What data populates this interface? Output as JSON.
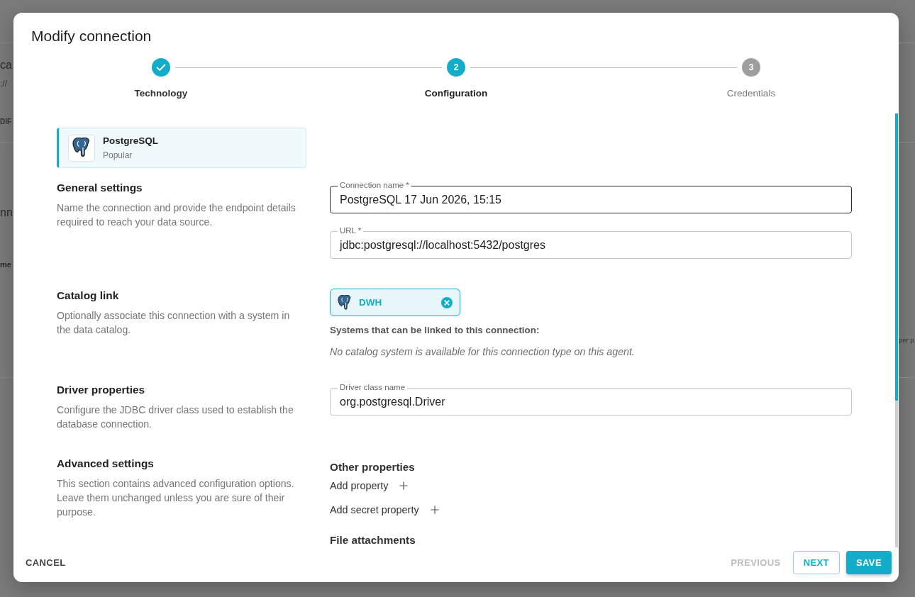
{
  "background_page": {
    "title": "ca",
    "subtitle": "://",
    "tab": "DIF",
    "section_title": "nn",
    "column_header": "me",
    "cell_text": "per p"
  },
  "dialog": {
    "title": "Modify connection",
    "steps": [
      {
        "label": "Technology",
        "completed": true,
        "selected": false
      },
      {
        "label": "Configuration",
        "number": "2",
        "completed": false,
        "selected": true
      },
      {
        "label": "Credentials",
        "number": "3",
        "completed": false,
        "selected": false
      }
    ],
    "technology": {
      "name": "PostgreSQL",
      "tag": "Popular",
      "selected": true
    },
    "sections": [
      {
        "kind": "fields",
        "title": "General settings",
        "description": "Name the connection and provide the endpoint details required to reach your data source.",
        "fields": [
          {
            "label": "Connection name *",
            "value": "PostgreSQL 17 Jun 2026, 15:15",
            "focused": true
          },
          {
            "label": "URL *",
            "value": "jdbc:postgresql://localhost:5432/postgres",
            "focused": false
          }
        ]
      },
      {
        "kind": "catalog",
        "title": "Catalog link",
        "description": "Optionally associate this connection with a system in the data catalog.",
        "linked_systems": [
          {
            "name": "DWH"
          }
        ],
        "available_heading": "Systems that can be linked to this connection:",
        "empty_note": "No catalog system is available for this connection type on this agent."
      },
      {
        "kind": "fields",
        "title": "Driver properties",
        "description": "Configure the JDBC driver class used to establish the database connection.",
        "fields": [
          {
            "label": "Driver class name",
            "value": "org.postgresql.Driver",
            "focused": false
          }
        ]
      },
      {
        "kind": "properties",
        "title": "Advanced settings",
        "description": "This section contains advanced configuration options. Leave them unchanged unless you are sure of their purpose.",
        "groups": [
          {
            "title": "Other properties",
            "actions": [
              "Add property",
              "Add secret property"
            ]
          },
          {
            "title": "File attachments"
          }
        ]
      }
    ],
    "footer": {
      "left_buttons": [
        {
          "label": "CANCEL",
          "kind": "text",
          "disabled": false
        }
      ],
      "right_buttons": [
        {
          "label": "PREVIOUS",
          "kind": "text",
          "disabled": true
        },
        {
          "label": "NEXT",
          "kind": "outlined",
          "disabled": false
        },
        {
          "label": "SAVE",
          "kind": "contained",
          "disabled": false
        }
      ]
    }
  }
}
